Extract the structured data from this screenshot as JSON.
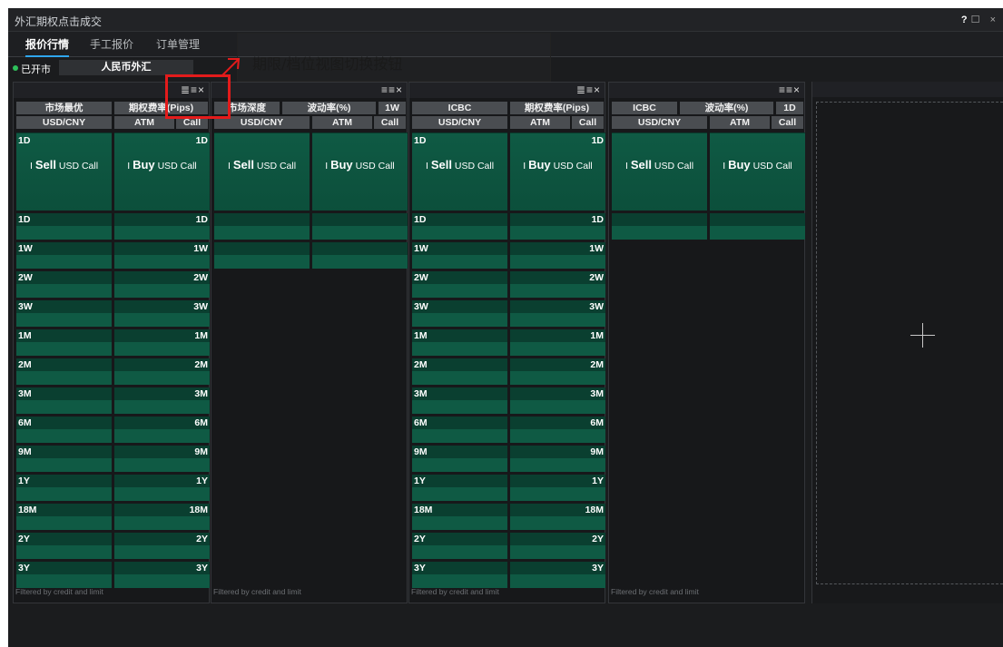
{
  "app": {
    "title": "外汇期权点击成交"
  },
  "window_controls": {
    "help": "?",
    "rest": "☐ ×"
  },
  "tabs": [
    {
      "label": "报价行情"
    },
    {
      "label": "手工报价"
    },
    {
      "label": "订单管理"
    }
  ],
  "status": {
    "label": "已开市",
    "market": "人民币外汇"
  },
  "annotation": {
    "text": "期限/档位视图切换按钮"
  },
  "footer_text": "Filtered by credit and limit",
  "panels": [
    {
      "icons": "≣≡×",
      "header1": [
        "市场最优",
        "期权费率(Pips)"
      ],
      "header2": [
        "USD/CNY",
        "ATM",
        "Call"
      ],
      "big_left_tenor": "1D",
      "big_right_tenor": "1D",
      "sell_prefix": "I ",
      "sell_label": "Sell",
      "sell_suffix": " USD Call",
      "buy_prefix": "I ",
      "buy_label": "Buy",
      "buy_suffix": " USD Call",
      "tenors": [
        "1D",
        "1W",
        "2W",
        "3W",
        "1M",
        "2M",
        "3M",
        "6M",
        "9M",
        "1Y",
        "18M",
        "2Y",
        "3Y"
      ]
    },
    {
      "icons": "≡≡×",
      "header1": [
        "市场深度",
        "波动率(%)",
        "1W"
      ],
      "header2": [
        "USD/CNY",
        "ATM",
        "Call"
      ],
      "big_left_tenor": "",
      "big_right_tenor": "",
      "sell_prefix": "I ",
      "sell_label": "Sell",
      "sell_suffix": " USD Call",
      "buy_prefix": "I ",
      "buy_label": "Buy",
      "buy_suffix": " USD Call",
      "tenors": [
        "",
        ""
      ]
    },
    {
      "icons": "≣≡×",
      "header1": [
        "ICBC",
        "期权费率(Pips)"
      ],
      "header2": [
        "USD/CNY",
        "ATM",
        "Call"
      ],
      "big_left_tenor": "1D",
      "big_right_tenor": "1D",
      "sell_prefix": "I ",
      "sell_label": "Sell",
      "sell_suffix": " USD Call",
      "buy_prefix": "I ",
      "buy_label": "Buy",
      "buy_suffix": " USD Call",
      "tenors": [
        "1D",
        "1W",
        "2W",
        "3W",
        "1M",
        "2M",
        "3M",
        "6M",
        "9M",
        "1Y",
        "18M",
        "2Y",
        "3Y"
      ]
    },
    {
      "icons": "≡≡×",
      "header1": [
        "ICBC",
        "波动率(%)",
        "1D"
      ],
      "header2": [
        "USD/CNY",
        "ATM",
        "Call"
      ],
      "big_left_tenor": "",
      "big_right_tenor": "",
      "sell_prefix": "I ",
      "sell_label": "Sell",
      "sell_suffix": " USD Call",
      "buy_prefix": "I ",
      "buy_label": "Buy",
      "buy_suffix": " USD Call",
      "tenors": [
        ""
      ]
    }
  ]
}
